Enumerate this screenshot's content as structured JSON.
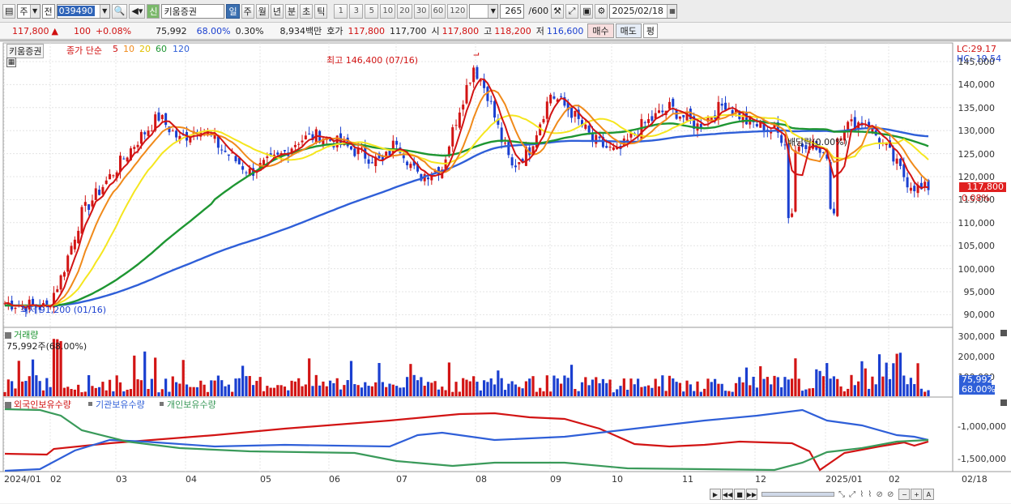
{
  "toolbar": {
    "market_combo": "주",
    "prev_combo": "전",
    "stock_code": "039490",
    "new_badge": "신",
    "stock_name": "키움증권",
    "period_tabs": [
      "일",
      "주",
      "월",
      "년",
      "분",
      "초",
      "틱"
    ],
    "selected_period": "일",
    "interval_buttons": [
      "1",
      "3",
      "5",
      "10",
      "20",
      "30",
      "60",
      "120"
    ],
    "count_text": "265",
    "count_max": "/600",
    "date_text": "2025/02/18"
  },
  "quote": {
    "price": "117,800",
    "change_arrow": "▲",
    "change": "100",
    "change_rate": "+0.08%",
    "volume": "75,992",
    "vol_ratio": "68.00%",
    "turnover": "0.30%",
    "amount": "8,934백만",
    "ask_label": "호가",
    "ask": "117,800",
    "bid": "117,700",
    "open_label": "시",
    "open": "117,800",
    "high_label": "고",
    "high": "118,200",
    "low_label": "저",
    "low": "116,600",
    "buy_button": "매수",
    "sell_button": "매도",
    "eval_button": "평"
  },
  "price_panel": {
    "stock_label": "키움증권",
    "legend_prefix": "종가 단순",
    "ma_periods": [
      "5",
      "10",
      "20",
      "60",
      "120"
    ],
    "ma_colors": [
      "#d21414",
      "#f08a1a",
      "#f5e61e",
      "#1e9632",
      "#2f5fd8"
    ],
    "lc": "LC:29.17",
    "hc": "HC:-19.54",
    "y_ticks": [
      "145,000",
      "140,000",
      "135,000",
      "130,000",
      "125,000",
      "120,000",
      "115,000",
      "110,000",
      "105,000",
      "100,000",
      "95,000",
      "90,000"
    ],
    "high_annotation": "최고 146,400 (07/16)",
    "low_annotation": "최저 91,200 (01/16)",
    "dividend_annotation": "배당락(0.00%)",
    "last_price_badge": "117,800",
    "last_rate_badge": "0.08%"
  },
  "volume_panel": {
    "title": "거래량",
    "summary": "75,992주(68.00%)",
    "y_ticks": [
      "300,000",
      "200,000",
      "100,000"
    ],
    "last_volume_badge": "75,992",
    "last_ratio_badge": "68.00%"
  },
  "holdings_panel": {
    "legends": [
      "외국인보유수량",
      "기관보유수량",
      "개인보유수량"
    ],
    "colors": [
      "#d21414",
      "#2f5fd8",
      "#3a9a5a"
    ],
    "y_ticks": [
      "-1,000,000",
      "-1,500,000"
    ]
  },
  "x_axis": {
    "labels": [
      "2024/01",
      "02",
      "03",
      "04",
      "05",
      "06",
      "07",
      "08",
      "09",
      "10",
      "11",
      "12",
      "2025/01",
      "02"
    ],
    "right_label": "02/18"
  }
}
